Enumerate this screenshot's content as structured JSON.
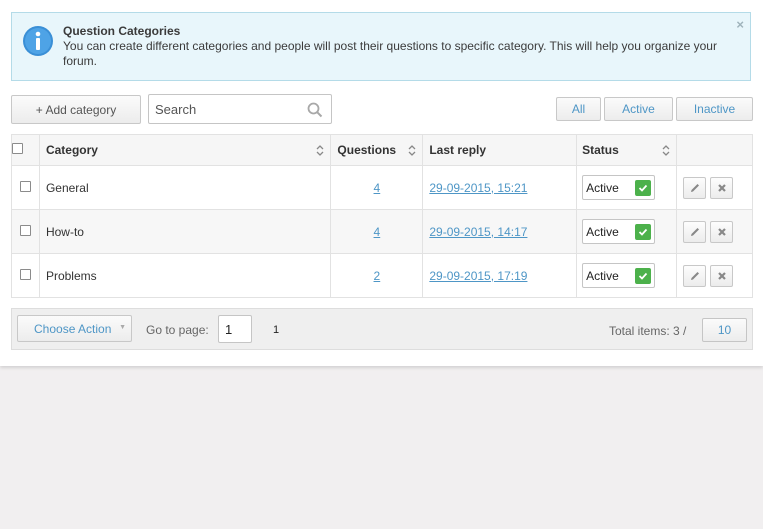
{
  "info": {
    "title": "Question Categories",
    "text": "You can create different categories and people will post their questions to specific category. This will help you organize your forum.",
    "close": "×"
  },
  "toolbar": {
    "add_label": "+ Add category",
    "search_placeholder": "Search",
    "search_value": "",
    "filters": {
      "all": "All",
      "active": "Active",
      "inactive": "Inactive"
    }
  },
  "table": {
    "headers": {
      "category": "Category",
      "questions": "Questions",
      "last_reply": "Last reply",
      "status": "Status"
    },
    "rows": [
      {
        "category": "General",
        "questions": "4",
        "last_reply": "29-09-2015, 15:21",
        "status": "Active"
      },
      {
        "category": "How-to",
        "questions": "4",
        "last_reply": "29-09-2015, 14:17",
        "status": "Active"
      },
      {
        "category": "Problems",
        "questions": "2",
        "last_reply": "29-09-2015, 17:19",
        "status": "Active"
      }
    ]
  },
  "footer": {
    "choose_action": "Choose Action",
    "goto_label": "Go to page:",
    "goto_value": "1",
    "page_link": "1",
    "total_label": "Total items: 3 /",
    "per_page": "10"
  },
  "colors": {
    "accent": "#4e96c6",
    "status_ok": "#4cb14b",
    "info_bg": "#e8f6fb"
  },
  "icons": {
    "info": "info-circle-icon",
    "search": "magnifier-icon",
    "edit": "pencil-icon",
    "delete": "x-icon",
    "sort": "sort-arrows-icon",
    "ok": "check-icon"
  }
}
